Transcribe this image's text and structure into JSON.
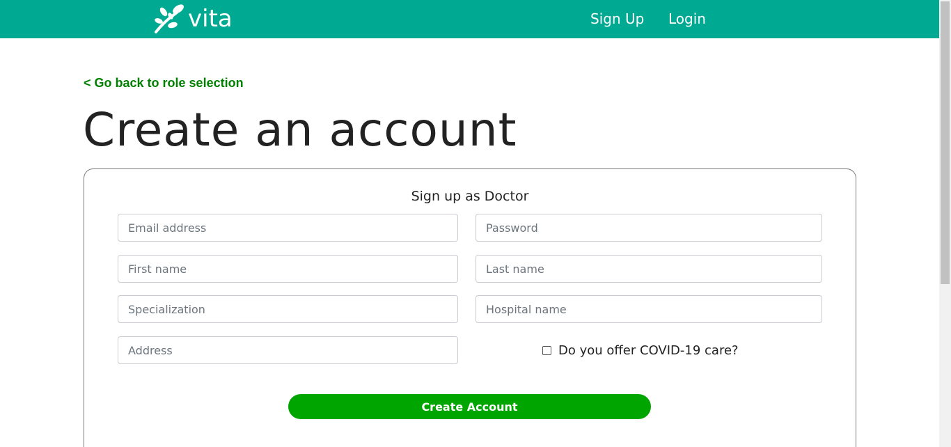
{
  "navbar": {
    "logo_text": "vita",
    "links": {
      "signup": "Sign Up",
      "login": "Login"
    }
  },
  "back_link": "< Go back to role selection",
  "page_title": "Create an account",
  "form": {
    "title": "Sign up as Doctor",
    "fields": {
      "email": {
        "placeholder": "Email address",
        "value": ""
      },
      "password": {
        "placeholder": "Password",
        "value": ""
      },
      "first_name": {
        "placeholder": "First name",
        "value": ""
      },
      "last_name": {
        "placeholder": "Last name",
        "value": ""
      },
      "specialization": {
        "placeholder": "Specialization",
        "value": ""
      },
      "hospital": {
        "placeholder": "Hospital name",
        "value": ""
      },
      "address": {
        "placeholder": "Address",
        "value": ""
      }
    },
    "covid_label": "Do you offer COVID-19 care?",
    "covid_checked": false,
    "submit_label": "Create Account"
  },
  "colors": {
    "navbar": "#00a991",
    "back_link": "#008000",
    "button": "#00a500"
  },
  "icons": {
    "logo": "leaf-sprig-icon",
    "checkbox": "checkbox-unchecked-icon"
  }
}
